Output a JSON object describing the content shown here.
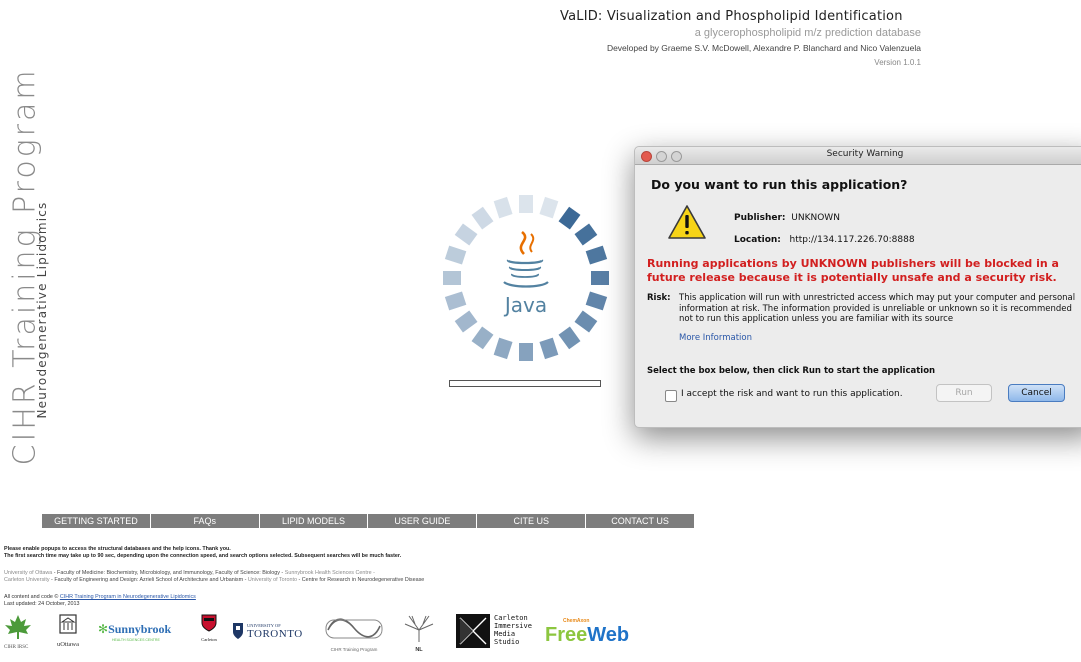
{
  "header": {
    "title": "VaLID: Visualization and Phospholipid Identification",
    "subtitle": "a glycerophospholipid m/z prediction database",
    "developers": "Developed by Graeme S.V. McDowell, Alexandre P. Blanchard and Nico Valenzuela",
    "version": "Version 1.0.1"
  },
  "branding": {
    "program": "CIHR Training Program",
    "field": "Neurodegenerative Lipidomics"
  },
  "java_splash": {
    "logo_text": "Java",
    "progress": 0
  },
  "dialog": {
    "title": "Security Warning",
    "question": "Do you want to run this application?",
    "publisher_label": "Publisher:",
    "publisher_value": "UNKNOWN",
    "location_label": "Location:",
    "location_value": "http://134.117.226.70:8888",
    "warning": "Running applications by UNKNOWN publishers will be blocked in a future release because it is potentially unsafe and a security risk.",
    "risk_label": "Risk:",
    "risk_text": "This application will run with unrestricted access which may put your computer and personal information at risk. The information provided is unreliable or unknown so it is recommended not to run this application unless you are familiar with its source",
    "more_info": "More Information",
    "instruction": "Select the box below, then click Run to start the application",
    "accept_label": "I accept the risk and want to run this application.",
    "accept_checked": false,
    "run_label": "Run",
    "cancel_label": "Cancel"
  },
  "nav": [
    "GETTING STARTED",
    "FAQs",
    "LIPID MODELS",
    "USER GUIDE",
    "CITE US",
    "CONTACT US"
  ],
  "footer": {
    "notice_1": "Please enable popups to access the structural databases and the help icons. Thank you.",
    "notice_2": "The first search time may take up to 90 sec, depending upon the connection speed, and search options selected. Subsequent searches will be much faster.",
    "aff1_link1": "University of Ottawa",
    "aff1_text1": " - Faculty of Medicine: Biochemistry, Microbiology, and Immunology, Faculty of Science: Biology - ",
    "aff1_link2": "Sunnybrook Health Sciences Centre -",
    "aff2_link1": "Carleton University",
    "aff2_text1": " - Faculty of Engineering and Design: Azrieli School of Architecture and Urbanism - ",
    "aff2_link2": "University of Toronto",
    "aff2_text2": " - Centre for Research in Neurodegenerative Disease",
    "copyright_prefix": "All content and code © ",
    "copyright_link": "CIHR Training Program in Neurodegenerative Lipidomics",
    "last_updated": "Last updated: 24 October, 2013"
  },
  "logos": {
    "cihr": "CIHR IRSC",
    "uottawa": "uOttawa",
    "sunnybrook": "Sunnybrook",
    "sunnybrook_sub": "HEALTH SCIENCES CENTRE",
    "carleton": "Carleton",
    "toronto_top": "UNIVERSITY OF",
    "toronto": "TORONTO",
    "cihr_program": "CIHR Training Program",
    "nl": "NL",
    "cims_1": "Carleton",
    "cims_2": "Immersive",
    "cims_3": "Media",
    "cims_4": "Studio",
    "chemaxon": "ChemAxon",
    "free": "Free",
    "web": "Web"
  },
  "colors": {
    "warning_red": "#d21f1f",
    "nav_gray": "#7d7d7d",
    "link_blue": "#2a57a8",
    "java_blue": "#5b8cc4",
    "freeweb_green": "#8cc63f",
    "freeweb_blue": "#1f73c8"
  }
}
